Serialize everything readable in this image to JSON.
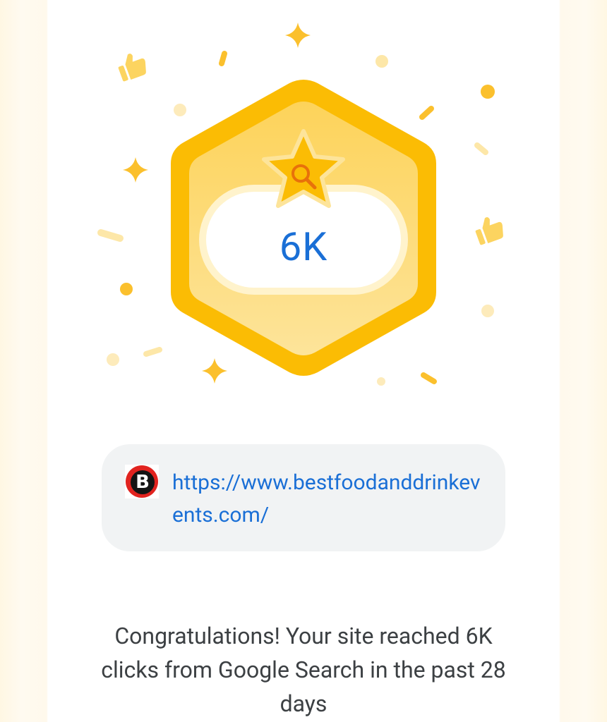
{
  "badge": {
    "value": "6K",
    "emblem_icon": "search-star-icon",
    "decorations": [
      "thumbs-up-icon",
      "sparkle-icon",
      "confetti-dot",
      "confetti-dash"
    ]
  },
  "site": {
    "logo_letter": "B",
    "url": "https://www.bestfoodanddrinkevents.com/"
  },
  "message": "Congratulations! Your site reached 6K clicks from Google Search in the past 28 days",
  "colors": {
    "badge_outer": "#fbbc04",
    "badge_inner": "#fdd663",
    "link": "#1a6fd6",
    "card_bg": "#f1f3f4",
    "text": "#3c4043"
  }
}
